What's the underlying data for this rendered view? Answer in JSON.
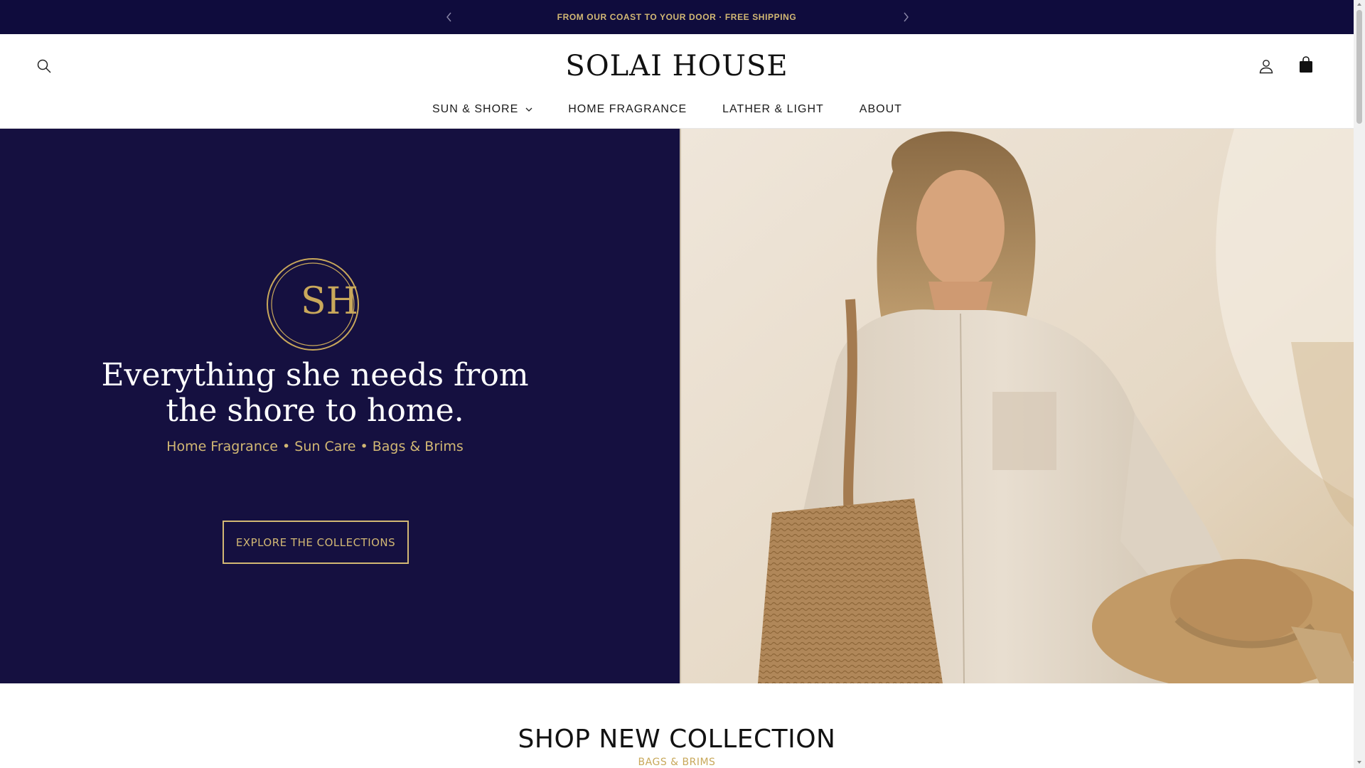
{
  "announcement": {
    "text": "FROM OUR COAST TO YOUR DOOR · FREE SHIPPING",
    "prev_icon": "chevron-left-icon",
    "next_icon": "chevron-right-icon"
  },
  "header": {
    "logo_text": "SOLAI HOUSE",
    "search_icon": "search-icon",
    "account_icon": "account-icon",
    "cart_icon": "shopping-bag-icon",
    "nav": [
      {
        "label": "SUN & SHORE",
        "has_dropdown": true
      },
      {
        "label": "HOME FRAGRANCE",
        "has_dropdown": false
      },
      {
        "label": "LATHER & LIGHT",
        "has_dropdown": false
      },
      {
        "label": "ABOUT",
        "has_dropdown": false
      }
    ]
  },
  "hero": {
    "monogram": "SH",
    "title": "Everything she needs from the shore to home.",
    "subtitle": "Home Fragrance • Sun Care • Bags & Brims",
    "cta_label": "EXPLORE THE COLLECTIONS",
    "colors": {
      "background": "#151040",
      "accent": "#d2b874"
    }
  },
  "shop_section": {
    "title": "SHOP NEW COLLECTION",
    "subtitle": "BAGS & BRIMS"
  }
}
